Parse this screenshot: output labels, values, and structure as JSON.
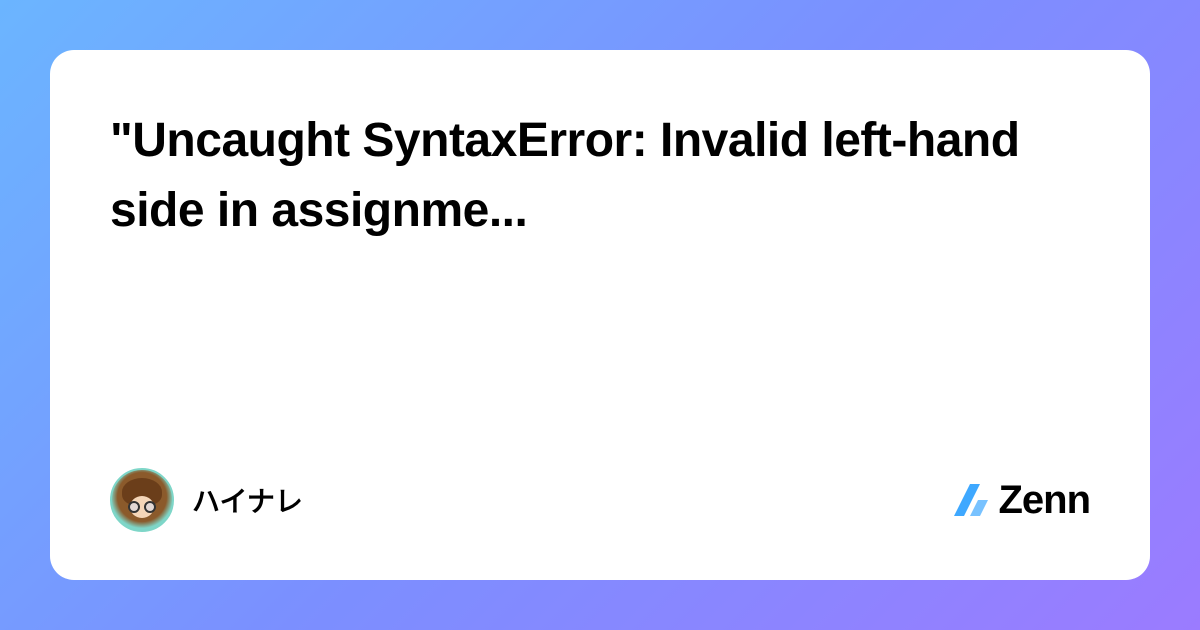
{
  "card": {
    "title": "\"Uncaught SyntaxError: Invalid left-hand side in assignme..."
  },
  "author": {
    "name": "ハイナレ"
  },
  "brand": {
    "name": "Zenn",
    "accent_color": "#3ea8ff"
  }
}
